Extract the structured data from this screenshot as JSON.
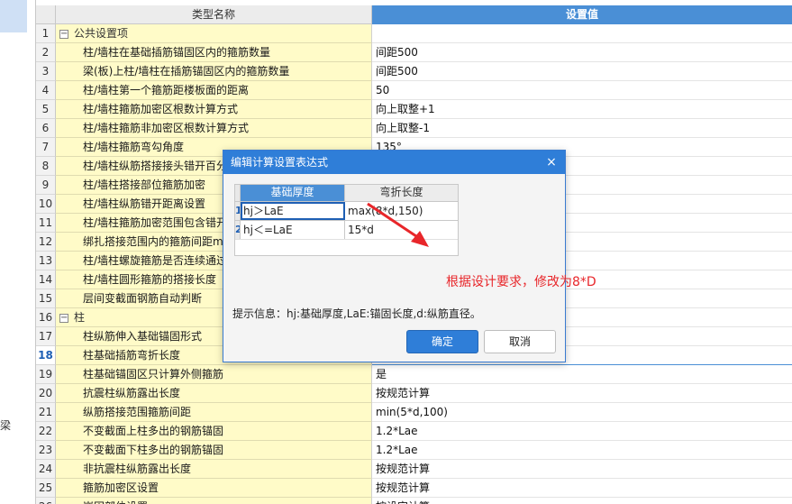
{
  "left_panel": {
    "text": "梁"
  },
  "header": {
    "name": "类型名称",
    "value": "设置值"
  },
  "rows": [
    {
      "num": "1",
      "name": "公共设置项",
      "value": "",
      "group": true
    },
    {
      "num": "2",
      "name": "柱/墙柱在基础插筋锚固区内的箍筋数量",
      "value": "间距500"
    },
    {
      "num": "3",
      "name": "梁(板)上柱/墙柱在插筋锚固区内的箍筋数量",
      "value": "间距500"
    },
    {
      "num": "4",
      "name": "柱/墙柱第一个箍筋距楼板面的距离",
      "value": "50"
    },
    {
      "num": "5",
      "name": "柱/墙柱箍筋加密区根数计算方式",
      "value": "向上取整+1"
    },
    {
      "num": "6",
      "name": "柱/墙柱箍筋非加密区根数计算方式",
      "value": "向上取整-1"
    },
    {
      "num": "7",
      "name": "柱/墙柱箍筋弯勾角度",
      "value": "135°"
    },
    {
      "num": "8",
      "name": "柱/墙柱纵筋搭接接头错开百分",
      "value": ""
    },
    {
      "num": "9",
      "name": "柱/墙柱搭接部位箍筋加密",
      "value": ""
    },
    {
      "num": "10",
      "name": "柱/墙柱纵筋错开距离设置",
      "value": ""
    },
    {
      "num": "11",
      "name": "柱/墙柱箍筋加密范围包含错开",
      "value": ""
    },
    {
      "num": "12",
      "name": "绑扎搭接范围内的箍筋间距m",
      "value": ""
    },
    {
      "num": "13",
      "name": "柱/墙柱螺旋箍筋是否连续通过",
      "value": ""
    },
    {
      "num": "14",
      "name": "柱/墙柱圆形箍筋的搭接长度",
      "value": ""
    },
    {
      "num": "15",
      "name": "层间变截面钢筋自动判断",
      "value": ""
    },
    {
      "num": "16",
      "name": "柱",
      "value": "",
      "group": true
    },
    {
      "num": "17",
      "name": "柱纵筋伸入基础锚固形式",
      "value": ""
    },
    {
      "num": "18",
      "name": "柱基础插筋弯折长度",
      "value": "",
      "active": true
    },
    {
      "num": "19",
      "name": "柱基础锚固区只计算外侧箍筋",
      "value": "是"
    },
    {
      "num": "20",
      "name": "抗震柱纵筋露出长度",
      "value": "按规范计算"
    },
    {
      "num": "21",
      "name": "纵筋搭接范围箍筋间距",
      "value": "min(5*d,100)"
    },
    {
      "num": "22",
      "name": "不变截面上柱多出的钢筋锚固",
      "value": "1.2*Lae"
    },
    {
      "num": "23",
      "name": "不变截面下柱多出的钢筋锚固",
      "value": "1.2*Lae"
    },
    {
      "num": "24",
      "name": "非抗震柱纵筋露出长度",
      "value": "按规范计算"
    },
    {
      "num": "25",
      "name": "箍筋加密区设置",
      "value": "按规范计算"
    },
    {
      "num": "26",
      "name": "嵌固部位设置",
      "value": "按设定计算"
    }
  ],
  "dialog": {
    "title": "编辑计算设置表达式",
    "close": "×",
    "columns": {
      "c1": "基础厚度",
      "c2": "弯折长度"
    },
    "rows": [
      {
        "num": "1",
        "c1": "hj＞LaE",
        "c2": "max(8*d,150)"
      },
      {
        "num": "2",
        "c1": "hj＜=LaE",
        "c2": "15*d"
      }
    ],
    "tip": "提示信息：hj:基础厚度,LaE:锚固长度,d:纵筋直径。",
    "ok": "确定",
    "cancel": "取消"
  },
  "annotation": {
    "text": "根据设计要求，修改为8*D",
    "color": "#e8262a"
  }
}
